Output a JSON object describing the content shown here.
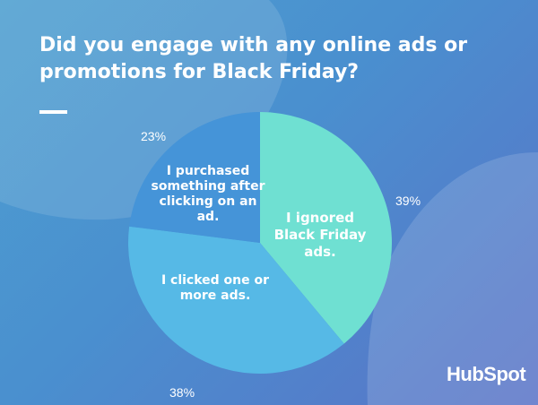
{
  "chart_data": {
    "type": "pie",
    "title": "Did you engage with any online ads or promotions for Black Friday?",
    "slices": [
      {
        "label": "I ignored Black Friday ads.",
        "value": 39,
        "value_label": "39%",
        "color": "#6fe0d2"
      },
      {
        "label": "I clicked one or more ads.",
        "value": 38,
        "value_label": "38%",
        "color": "#56b9e6"
      },
      {
        "label": "I purchased something after clicking on an ad.",
        "value": 23,
        "value_label": "23%",
        "color": "#4594d8"
      }
    ]
  },
  "brand": {
    "logo_text": "HubSpot"
  }
}
